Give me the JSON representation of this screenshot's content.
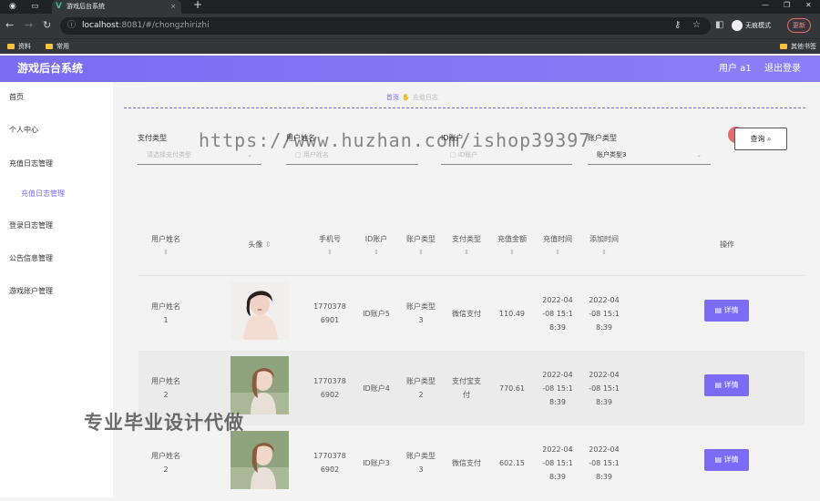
{
  "browser": {
    "tab_title": "游戏后台系统",
    "url_host": "localhost",
    "url_rest": ":8081/#/chongzhirizhi",
    "incognito": "无痕模式",
    "update": "更新",
    "bookmarks": [
      "资料",
      "常用",
      "其他书签"
    ]
  },
  "header": {
    "title": "游戏后台系统",
    "user": "用户 a1",
    "logout": "退出登录"
  },
  "sidebar": {
    "items": [
      "首页",
      "个人中心",
      "充值日志管理",
      "充值日志管理",
      "登录日志管理",
      "公告信息管理",
      "游戏账户管理"
    ]
  },
  "breadcrumb": {
    "home": "首页",
    "current": "充值日志"
  },
  "filters": {
    "pay_type": {
      "label": "支付类型",
      "placeholder": "请选择支付类型"
    },
    "user_name": {
      "label": "用户姓名",
      "placeholder": "用户姓名"
    },
    "id_account": {
      "label": "ID账户",
      "placeholder": "ID账户"
    },
    "account_type": {
      "label": "账户类型",
      "value": "账户类型3"
    },
    "query": "查询"
  },
  "table": {
    "headers": [
      "用户姓名",
      "头像",
      "手机号",
      "ID账户",
      "账户类型",
      "支付类型",
      "充值金额",
      "充值时间",
      "添加时间",
      "操作"
    ],
    "rows": [
      {
        "name": "用户姓名\n1",
        "phone": "1770378\n6901",
        "id": "ID账户5",
        "type": "账户类型\n3",
        "pay": "微信支付",
        "amount": "110.49",
        "time": "2022-04\n-08 15:1\n8:39",
        "added": "2022-04\n-08 15:1\n8:39",
        "action": "详情"
      },
      {
        "name": "用户姓名\n2",
        "phone": "1770378\n6902",
        "id": "ID账户4",
        "type": "账户类型\n2",
        "pay": "支付宝支\n付",
        "amount": "770.61",
        "time": "2022-04\n-08 15:1\n8:39",
        "added": "2022-04\n-08 15:1\n8:39",
        "action": "详情"
      },
      {
        "name": "用户姓名\n2",
        "phone": "1770378\n6902",
        "id": "ID账户3",
        "type": "账户类型\n3",
        "pay": "微信支付",
        "amount": "602.15",
        "time": "2022-04\n-08 15:1\n8:39",
        "added": "2022-04\n-08 15:1\n8:39",
        "action": "详情"
      }
    ]
  },
  "watermarks": {
    "url": "https://www.huzhan.com/ishop39397",
    "text": "专业毕业设计代做"
  },
  "colors": {
    "accent": "#7b6cf6",
    "header": "#7a6cf3"
  }
}
